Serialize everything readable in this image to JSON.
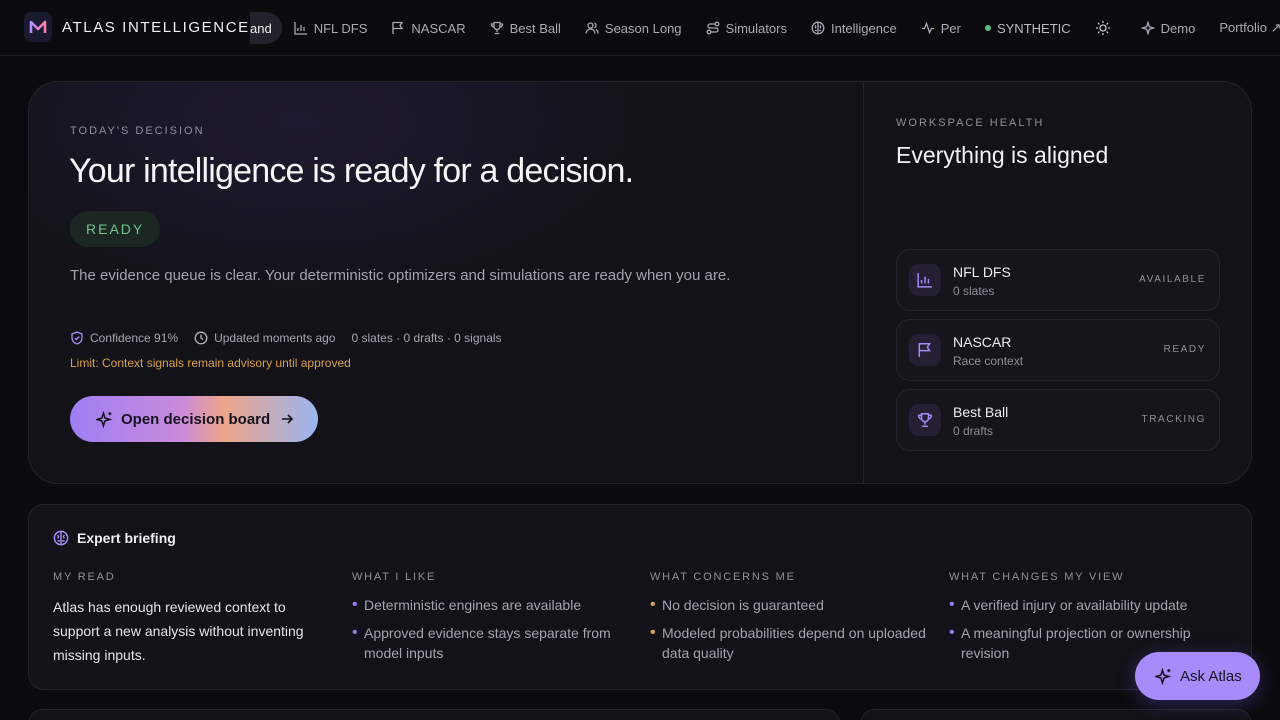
{
  "brand": {
    "name": "ATLAS INTELLIGENCE",
    "logo_letter": "M"
  },
  "nav": {
    "items": [
      {
        "label": "and",
        "icon": "none",
        "active": true
      },
      {
        "label": "NFL DFS",
        "icon": "bar-chart-icon"
      },
      {
        "label": "NASCAR",
        "icon": "flag-icon"
      },
      {
        "label": "Best Ball",
        "icon": "trophy-icon"
      },
      {
        "label": "Season Long",
        "icon": "users-icon"
      },
      {
        "label": "Simulators",
        "icon": "route-icon"
      },
      {
        "label": "Intelligence",
        "icon": "brain-icon"
      },
      {
        "label": "Per",
        "icon": "activity-icon"
      }
    ],
    "status_label": "SYNTHETIC",
    "status_color": "#5fbf86",
    "theme_toggle_icon": "sun-icon",
    "demo_label": "Demo",
    "portfolio_label": "Portfolio ↗"
  },
  "hero": {
    "eyebrow": "TODAY'S DECISION",
    "title": "Your intelligence is ready for a decision.",
    "badge": "READY",
    "description": "The evidence queue is clear. Your deterministic optimizers and simulations are ready when you are.",
    "confidence": "Confidence 91%",
    "updated": "Updated moments ago",
    "counts": "0 slates · 0 drafts · 0 signals",
    "limit": "Limit: Context signals remain advisory until approved",
    "cta_label": "Open decision board"
  },
  "workspace": {
    "eyebrow": "WORKSPACE HEALTH",
    "title": "Everything is aligned",
    "cards": [
      {
        "name": "NFL DFS",
        "sub": "0 slates",
        "status": "AVAILABLE",
        "icon": "bar-chart-icon"
      },
      {
        "name": "NASCAR",
        "sub": "Race context",
        "status": "READY",
        "icon": "flag-icon"
      },
      {
        "name": "Best Ball",
        "sub": "0 drafts",
        "status": "TRACKING",
        "icon": "trophy-icon"
      }
    ]
  },
  "briefing": {
    "title": "Expert briefing",
    "my_read": {
      "title": "MY READ",
      "text": "Atlas has enough reviewed context to support a new analysis without inventing missing inputs."
    },
    "likes": {
      "title": "WHAT I LIKE",
      "items": [
        "Deterministic engines are available",
        "Approved evidence stays separate from model inputs"
      ]
    },
    "concerns": {
      "title": "WHAT CONCERNS ME",
      "items": [
        "No decision is guaranteed",
        "Modeled probabilities depend on uploaded data quality"
      ]
    },
    "changes": {
      "title": "WHAT CHANGES MY VIEW",
      "items": [
        "A verified injury or availability update",
        "A meaningful projection or ownership revision"
      ]
    }
  },
  "ask_label": "Ask Atlas",
  "colors": {
    "accent": "#a78bfa",
    "ready": "#6fc28d",
    "warning": "#d9a045"
  }
}
